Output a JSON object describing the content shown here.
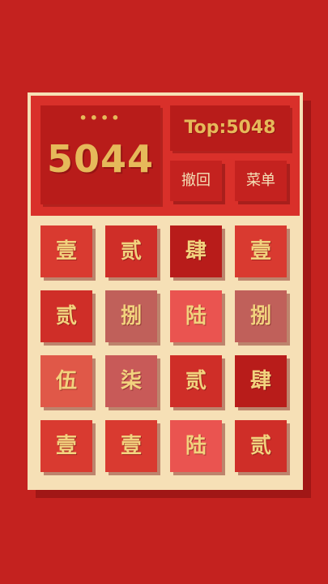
{
  "header": {
    "dots": "••••",
    "score": "5044",
    "top_score": "Top:5048",
    "undo_label": "撤回",
    "menu_label": "菜单"
  },
  "colors": {
    "background": "#c4221f",
    "board": "#f6e0b6",
    "tile_text": "#f2d27e"
  },
  "grid": [
    [
      "壹",
      "贰",
      "肆",
      "壹"
    ],
    [
      "贰",
      "捌",
      "陆",
      "捌"
    ],
    [
      "伍",
      "柒",
      "贰",
      "肆"
    ],
    [
      "壹",
      "壹",
      "陆",
      "贰"
    ]
  ]
}
